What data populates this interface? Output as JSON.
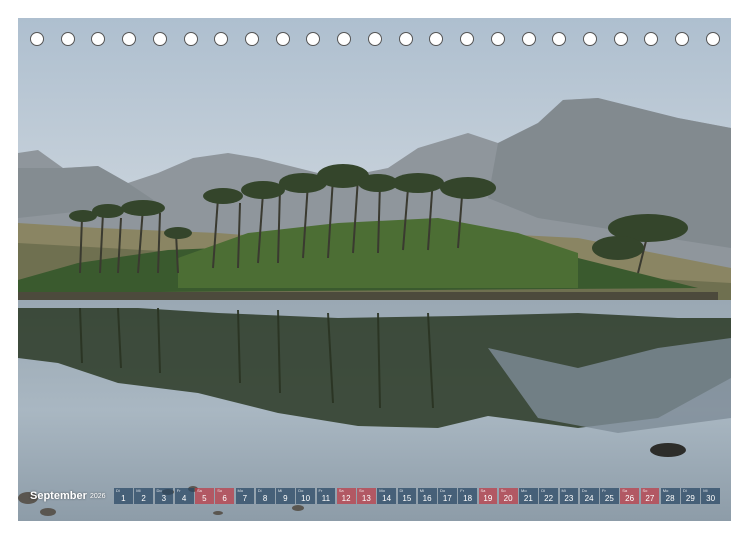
{
  "calendar": {
    "month": "September",
    "year": "2026",
    "days": [
      {
        "d": "1",
        "n": "Di",
        "we": false
      },
      {
        "d": "2",
        "n": "Mi",
        "we": false
      },
      {
        "d": "3",
        "n": "Do",
        "we": false
      },
      {
        "d": "4",
        "n": "Fr",
        "we": false
      },
      {
        "d": "5",
        "n": "Sa",
        "we": true
      },
      {
        "d": "6",
        "n": "So",
        "we": true
      },
      {
        "d": "7",
        "n": "Mo",
        "we": false
      },
      {
        "d": "8",
        "n": "Di",
        "we": false
      },
      {
        "d": "9",
        "n": "Mi",
        "we": false
      },
      {
        "d": "10",
        "n": "Do",
        "we": false
      },
      {
        "d": "11",
        "n": "Fr",
        "we": false
      },
      {
        "d": "12",
        "n": "Sa",
        "we": true
      },
      {
        "d": "13",
        "n": "So",
        "we": true
      },
      {
        "d": "14",
        "n": "Mo",
        "we": false
      },
      {
        "d": "15",
        "n": "Di",
        "we": false
      },
      {
        "d": "16",
        "n": "Mi",
        "we": false
      },
      {
        "d": "17",
        "n": "Do",
        "we": false
      },
      {
        "d": "18",
        "n": "Fr",
        "we": false
      },
      {
        "d": "19",
        "n": "Sa",
        "we": true
      },
      {
        "d": "20",
        "n": "So",
        "we": true
      },
      {
        "d": "21",
        "n": "Mo",
        "we": false
      },
      {
        "d": "22",
        "n": "Di",
        "we": false
      },
      {
        "d": "23",
        "n": "Mi",
        "we": false
      },
      {
        "d": "24",
        "n": "Do",
        "we": false
      },
      {
        "d": "25",
        "n": "Fr",
        "we": false
      },
      {
        "d": "26",
        "n": "Sa",
        "we": true
      },
      {
        "d": "27",
        "n": "So",
        "we": true
      },
      {
        "d": "28",
        "n": "Mo",
        "we": false
      },
      {
        "d": "29",
        "n": "Di",
        "we": false
      },
      {
        "d": "30",
        "n": "Mi",
        "we": false
      }
    ]
  },
  "colors": {
    "weekday_cell": "#284664",
    "weekend_cell": "#be3c46",
    "sky": "#b9c9d6",
    "water": "#9fb0bd"
  }
}
